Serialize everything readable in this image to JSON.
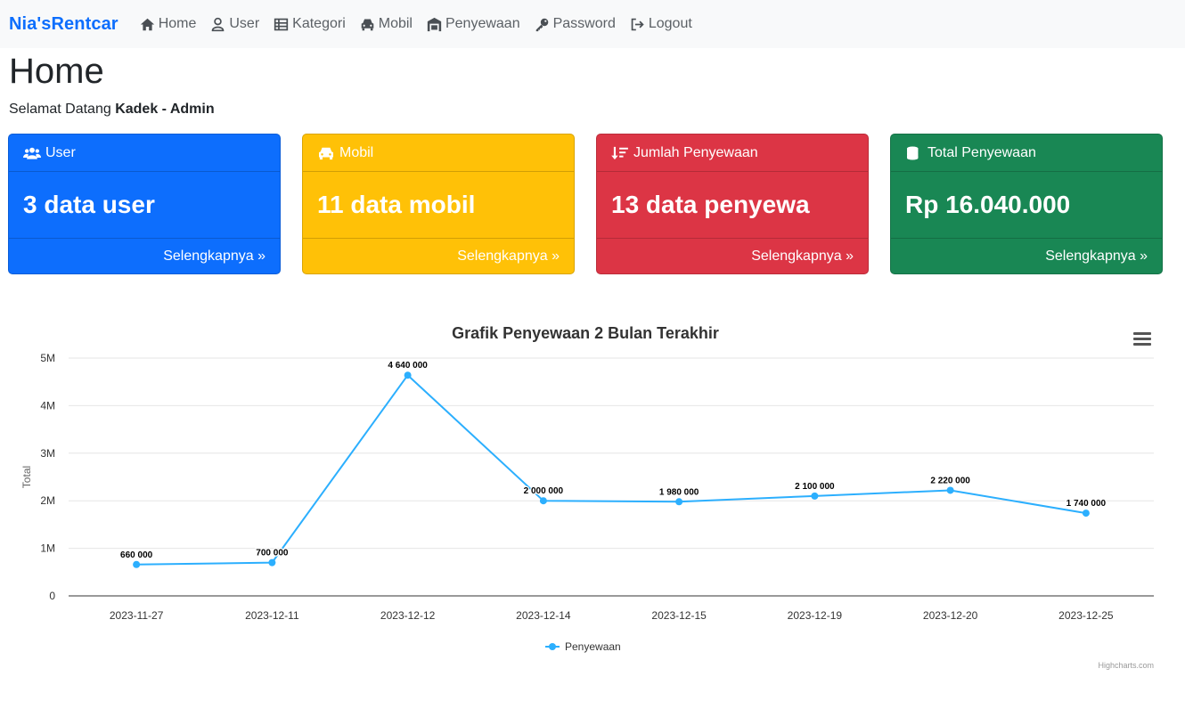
{
  "navbar": {
    "brand": "Nia'sRentcar",
    "items": [
      {
        "label": "Home",
        "icon": "home-icon"
      },
      {
        "label": "User",
        "icon": "user-icon"
      },
      {
        "label": "Kategori",
        "icon": "table-icon"
      },
      {
        "label": "Mobil",
        "icon": "car-icon"
      },
      {
        "label": "Penyewaan",
        "icon": "garage-icon"
      },
      {
        "label": "Password",
        "icon": "key-icon"
      },
      {
        "label": "Logout",
        "icon": "logout-icon"
      }
    ]
  },
  "page": {
    "title": "Home",
    "welcome_prefix": "Selamat Datang",
    "welcome_user": "Kadek - Admin"
  },
  "cards": [
    {
      "header": "User",
      "value": "3 data user",
      "footer": "Selengkapnya »",
      "color": "#0d6efd",
      "icon": "users-icon"
    },
    {
      "header": "Mobil",
      "value": "11 data mobil",
      "footer": "Selengkapnya »",
      "color": "#ffc107",
      "icon": "car-icon"
    },
    {
      "header": "Jumlah Penyewaan",
      "value": "13 data penyewa",
      "footer": "Selengkapnya »",
      "color": "#dc3545",
      "icon": "sort-icon"
    },
    {
      "header": "Total Penyewaan",
      "value": "Rp 16.040.000",
      "footer": "Selengkapnya »",
      "color": "#198754",
      "icon": "coins-icon"
    }
  ],
  "chart_data": {
    "type": "line",
    "title": "Grafik Penyewaan 2 Bulan Terakhir",
    "ylabel": "Total",
    "xlabel": "",
    "categories": [
      "2023-11-27",
      "2023-12-11",
      "2023-12-12",
      "2023-12-14",
      "2023-12-15",
      "2023-12-19",
      "2023-12-20",
      "2023-12-25"
    ],
    "series": [
      {
        "name": "Penyewaan",
        "values": [
          660000,
          700000,
          4640000,
          2000000,
          1980000,
          2100000,
          2220000,
          1740000
        ],
        "color": "#2caffe"
      }
    ],
    "data_labels": [
      "660 000",
      "700 000",
      "4 640 000",
      "2 000 000",
      "1 980 000",
      "2 100 000",
      "2 220 000",
      "1 740 000"
    ],
    "ylim": [
      0,
      5000000
    ],
    "yticks": [
      {
        "value": 0,
        "label": "0"
      },
      {
        "value": 1000000,
        "label": "1M"
      },
      {
        "value": 2000000,
        "label": "2M"
      },
      {
        "value": 3000000,
        "label": "3M"
      },
      {
        "value": 4000000,
        "label": "4M"
      },
      {
        "value": 5000000,
        "label": "5M"
      }
    ],
    "grid": true,
    "legend": "bottom-center",
    "credits": "Highcharts.com"
  }
}
